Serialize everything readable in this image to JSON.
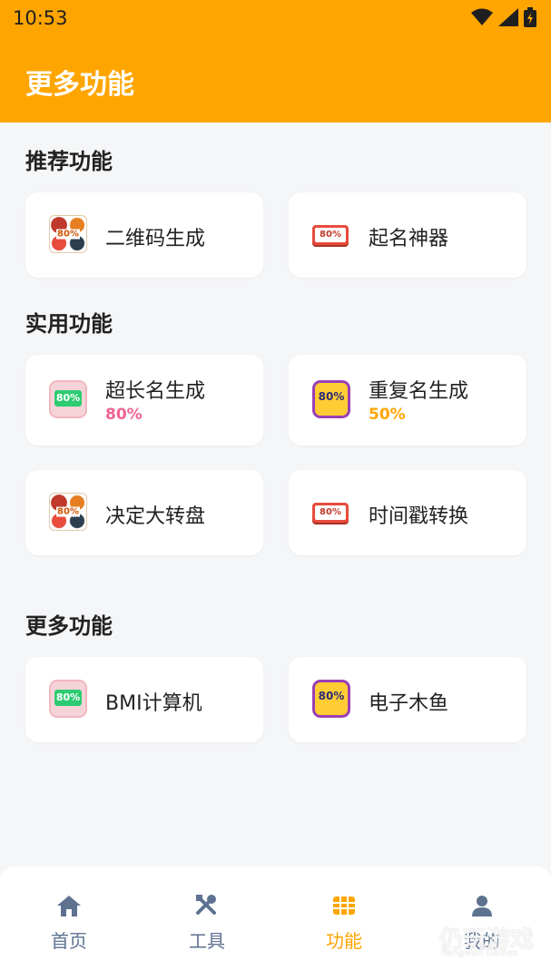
{
  "status_bar": {
    "time": "10:53",
    "icons": [
      "wifi-icon",
      "signal-icon",
      "battery-icon"
    ]
  },
  "header": {
    "title": "更多功能"
  },
  "sections": {
    "recommended": {
      "title": "推荐功能",
      "items": [
        {
          "label": "二维码生成",
          "icon": "qr-thumbnail-icon",
          "badge_text": "80%"
        },
        {
          "label": "起名神器",
          "icon": "ribbon-thumbnail-icon",
          "badge_text": "80%"
        }
      ]
    },
    "practical": {
      "title": "实用功能",
      "items": [
        {
          "label": "超长名生成",
          "sub": "80%",
          "sub_color": "#f06292",
          "icon": "green-thumbnail-icon",
          "badge_text": "80%"
        },
        {
          "label": "重复名生成",
          "sub": "50%",
          "sub_color": "#ffa500",
          "icon": "purple-thumbnail-icon",
          "badge_text": "80%"
        },
        {
          "label": "决定大转盘",
          "icon": "qr-thumbnail-icon",
          "badge_text": "80%"
        },
        {
          "label": "时间戳转换",
          "icon": "ribbon-thumbnail-icon",
          "badge_text": "80%"
        }
      ]
    },
    "more": {
      "title": "更多功能",
      "items": [
        {
          "label": "BMI计算机",
          "icon": "green-thumbnail-icon",
          "badge_text": "80%"
        },
        {
          "label": "电子木鱼",
          "icon": "purple-thumbnail-icon",
          "badge_text": "80%"
        }
      ]
    }
  },
  "tabbar": {
    "tabs": [
      {
        "label": "首页",
        "icon": "home-icon",
        "active": false
      },
      {
        "label": "工具",
        "icon": "tools-icon",
        "active": false
      },
      {
        "label": "功能",
        "icon": "grid-icon",
        "active": true
      },
      {
        "label": "我的",
        "icon": "person-icon",
        "active": false
      }
    ]
  },
  "watermark": {
    "text": "仍玩游戏",
    "sub": "Rengwan Games"
  },
  "colors": {
    "accent": "#ffa500",
    "tab_inactive": "#5e7290",
    "background": "#f5f6f8"
  }
}
